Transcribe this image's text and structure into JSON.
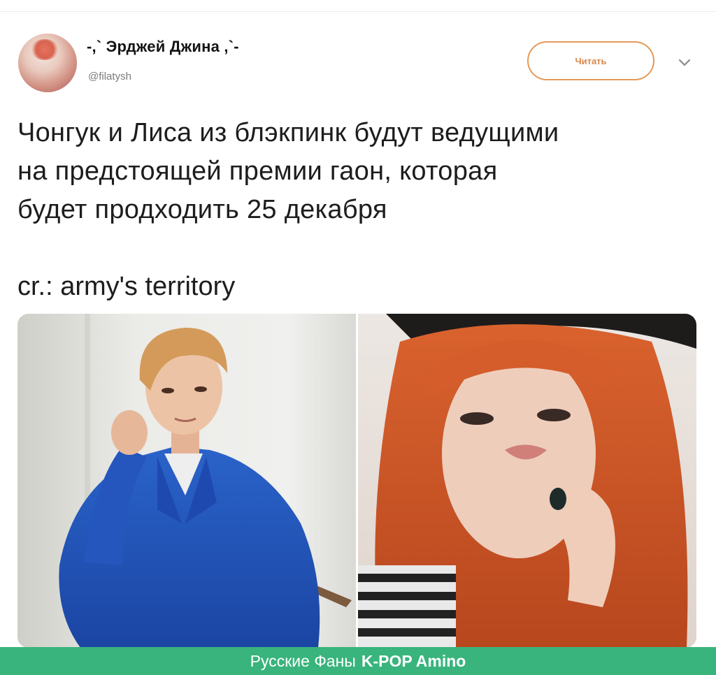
{
  "tweet": {
    "author": {
      "display_name": "-,` Эрджей Джина ,`-",
      "handle": "@filatysh"
    },
    "follow_button_label": "Читать",
    "text_lines": [
      "Чонгук и Лиса из блэкпинк будут ведущими",
      "на предстоящей премии гаон, которая",
      "будет продходить 25 декабря"
    ],
    "credit": "cr.: army's territory",
    "media": [
      {
        "subject": "photo-person-blue-jacket"
      },
      {
        "subject": "photo-person-orange-hair"
      }
    ]
  },
  "footer": {
    "label": "Русские Фаны",
    "brand": "K-POP Amino"
  },
  "colors": {
    "accent": "#e39a58",
    "footer_bg": "#38b47c"
  }
}
